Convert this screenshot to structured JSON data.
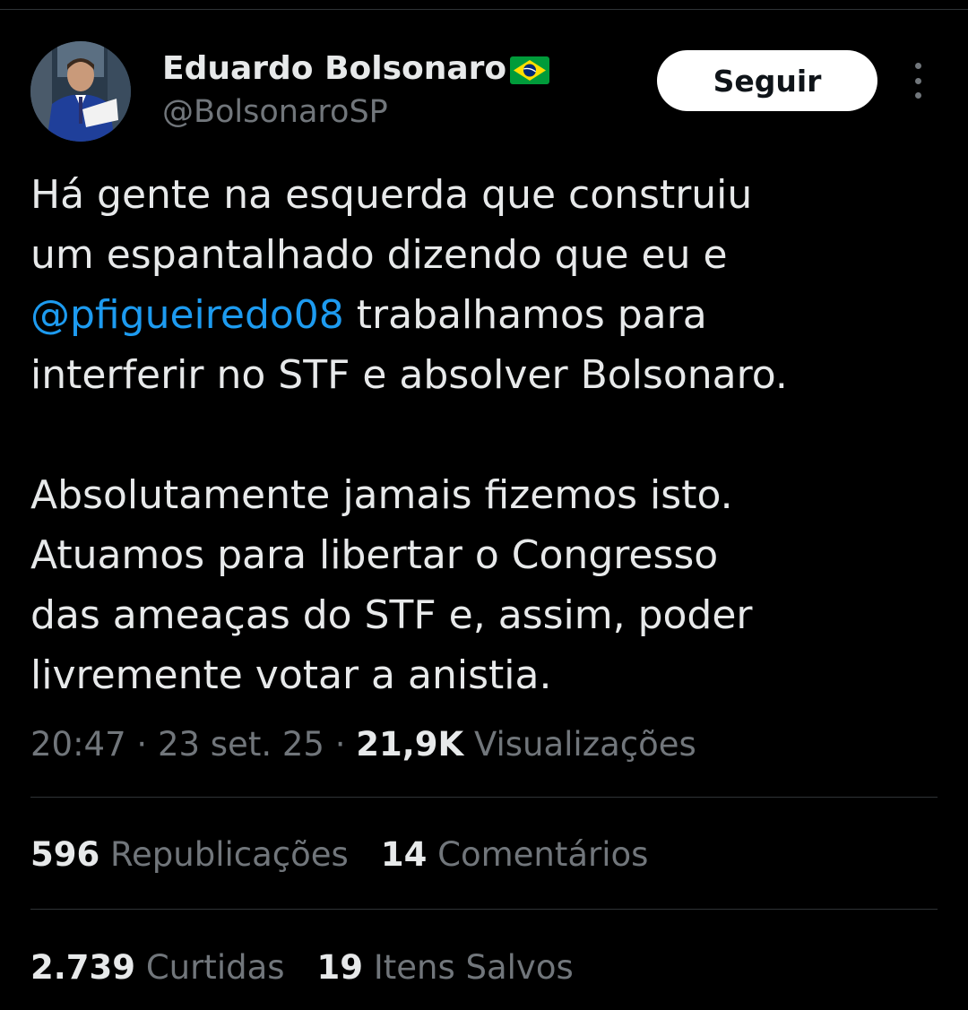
{
  "tweet": {
    "author": {
      "name": "Eduardo Bolsonaro",
      "flag": "brazil-flag",
      "handle": "@BolsonaroSP"
    },
    "follow_label": "Seguir",
    "more_icon": "more-vertical-icon",
    "lines": [
      [
        "Há gente na esquerda que construiu"
      ],
      [
        "um espantalhado dizendo que eu e"
      ],
      [
        "@pfigueiredo08",
        " trabalhamos para"
      ],
      [
        "interferir no STF e absolver Bolsonaro."
      ]
    ],
    "lines2": [
      "Absolutamente jamais fizemos isto.",
      "Atuamos para libertar o Congresso",
      "das ameaças do STF e, assim, poder",
      "livremente votar a anistia."
    ],
    "meta": {
      "time": "20:47",
      "sep": " · ",
      "date": "23 set. 25",
      "views_count": "21,9K",
      "views_label": " Visualizações"
    },
    "stats": [
      {
        "count": "596",
        "label": "Republicações"
      },
      {
        "count": "14",
        "label": "Comentários"
      }
    ],
    "stats2": [
      {
        "count": "2.739",
        "label": "Curtidas"
      },
      {
        "count": "19",
        "label": "Itens Salvos"
      }
    ]
  },
  "colors": {
    "background": "#000000",
    "text": "#e7e9ea",
    "secondary": "#71767b",
    "link": "#1d9bf0",
    "divider": "#2f3336"
  }
}
